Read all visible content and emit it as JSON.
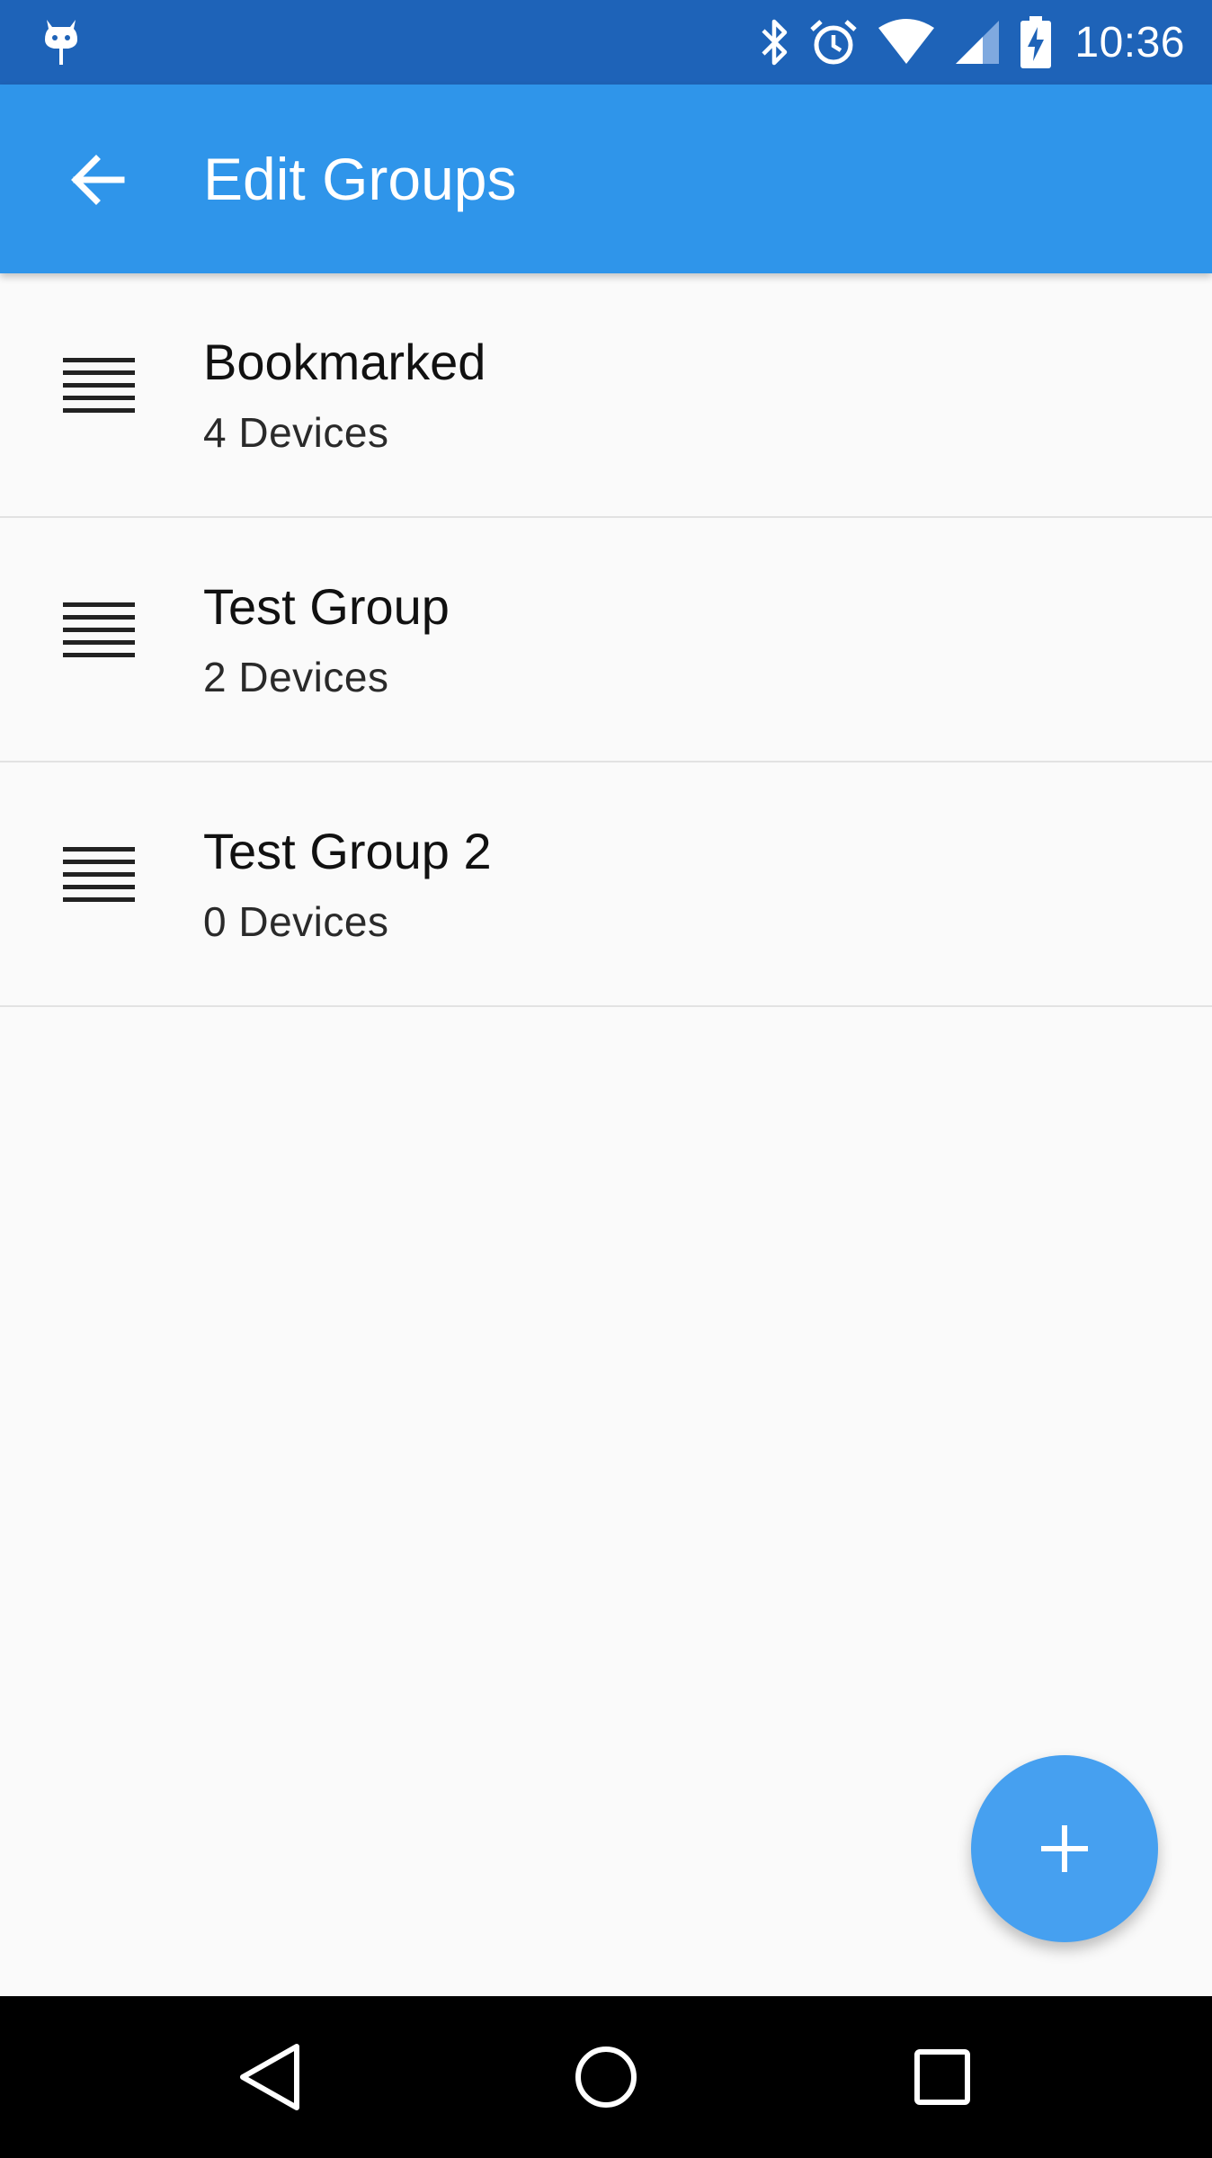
{
  "status_bar": {
    "time": "10:36",
    "icons": [
      "android-debug-icon",
      "bluetooth-icon",
      "alarm-icon",
      "wifi-icon",
      "cell-signal-icon",
      "battery-charging-icon"
    ]
  },
  "app_bar": {
    "title": "Edit Groups",
    "back_icon": "arrow-back-icon"
  },
  "groups": [
    {
      "name": "Bookmarked",
      "count": "4 Devices"
    },
    {
      "name": "Test Group",
      "count": "2 Devices"
    },
    {
      "name": "Test Group 2",
      "count": "0 Devices"
    }
  ],
  "fab": {
    "icon": "plus-icon"
  },
  "nav_bar": {
    "buttons": [
      "back-triangle-icon",
      "home-circle-icon",
      "recents-square-icon"
    ]
  },
  "colors": {
    "status_bar": "#1e63b8",
    "app_bar": "#2f95ea",
    "fab": "#46a0f0",
    "background": "#fafafa"
  }
}
